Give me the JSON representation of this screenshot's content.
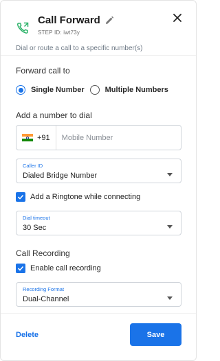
{
  "header": {
    "title": "Call Forward",
    "step_id": "STEP ID: iwt73y",
    "subtitle": "Dial or route a call to a specific number(s)",
    "icon": "phone-forward-icon",
    "accent_color": "#2fb36b"
  },
  "forward": {
    "label": "Forward call to",
    "options": [
      "Single Number",
      "Multiple Numbers"
    ],
    "selected": "Single Number"
  },
  "number": {
    "label": "Add a number to dial",
    "country_code": "+91",
    "placeholder": "Mobile Number",
    "value": ""
  },
  "caller_id": {
    "label": "Caller ID",
    "value": "Dialed Bridge Number"
  },
  "ringtone": {
    "label": "Add a Ringtone while connecting",
    "checked": true
  },
  "dial_timeout": {
    "label": "Dial timeout",
    "value": "30 Sec"
  },
  "recording": {
    "section_label": "Call Recording",
    "checkbox_label": "Enable call recording",
    "checked": true,
    "format_label": "Recording Format",
    "format_value": "Dual-Channel"
  },
  "footer": {
    "delete_label": "Delete",
    "save_label": "Save"
  },
  "colors": {
    "primary": "#1a73e8"
  }
}
